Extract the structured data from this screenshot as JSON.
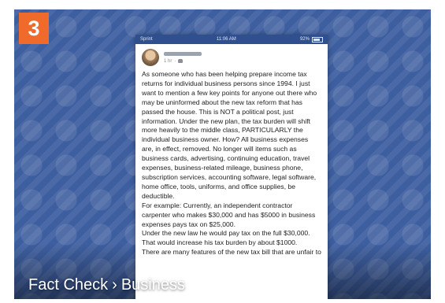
{
  "badge": {
    "number": "3"
  },
  "phone": {
    "status": {
      "carrier": "Sprint",
      "time": "11:06 AM",
      "battery": "92%"
    },
    "post": {
      "time": "1 hr"
    },
    "paragraphs": [
      "As someone who has been helping prepare income tax returns for individual business persons since 1994. I just want to mention a few key points for anyone out there who may be uninformed about the new tax reform that has passed the house. This is NOT a political post, just information. Under the new plan, the tax burden will shift more heavily to the middle class, PARTICULARLY the individual business owner. How? All business expenses are, in effect, removed. No longer will items such as business cards, advertising, continuing education, travel expenses, business-related mileage, business phone, subscription services, accounting software, legal software, home office, tools, uniforms, and office supplies, be deductible.",
      "For example: Currently, an independent contractor carpenter who makes $30,000 and has $5000 in business expenses pays tax on $25,000.",
      "Under the new law he would pay tax on the full $30,000. That would increase his tax burden by about $1000.",
      "There are many features of the new tax bill that are unfair to"
    ]
  },
  "caption": {
    "section": "Fact Check",
    "separator": "›",
    "category": "Business"
  },
  "colors": {
    "background_blue": "#3d5e9f",
    "badge_orange": "#ef6a2b",
    "status_bar": "#2f4f8f"
  }
}
